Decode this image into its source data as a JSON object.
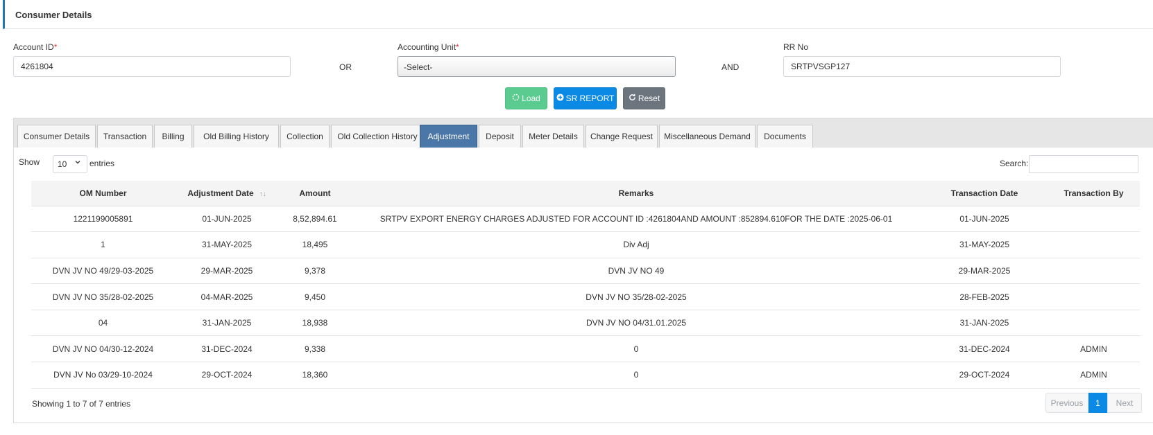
{
  "header": {
    "title": "Consumer Details"
  },
  "form": {
    "account_id": {
      "label": "Account ID",
      "required": "*",
      "value": "4261804"
    },
    "or_label": "OR",
    "accounting_unit": {
      "label": "Accounting Unit",
      "required": "*",
      "value": "-Select-"
    },
    "and_label": "AND",
    "rr_no": {
      "label": "RR No",
      "value": "SRTPVSGP127"
    }
  },
  "buttons": {
    "load": "Load",
    "sr_report": "SR REPORT",
    "reset": "Reset"
  },
  "tabs": [
    "Consumer Details",
    "Transaction",
    "Billing",
    "Old Billing History",
    "Collection",
    "Old Collection History",
    "Adjustment",
    "Deposit",
    "Meter Details",
    "Change Request",
    "Miscellaneous Demand",
    "Documents"
  ],
  "active_tab": "Adjustment",
  "table_controls": {
    "show_label": "Show",
    "page_length": "10",
    "entries_label": "entries",
    "search_label": "Search:"
  },
  "table": {
    "columns": [
      "OM Number",
      "Adjustment Date",
      "Amount",
      "Remarks",
      "Transaction Date",
      "Transaction By"
    ],
    "sort_icon": "↑↓",
    "rows": [
      [
        "1221199005891",
        "01-JUN-2025",
        "8,52,894.61",
        "SRTPV EXPORT ENERGY CHARGES ADJUSTED FOR ACCOUNT ID :4261804AND AMOUNT :852894.610FOR THE DATE :2025-06-01",
        "01-JUN-2025",
        ""
      ],
      [
        "1",
        "31-MAY-2025",
        "18,495",
        "Div Adj",
        "31-MAY-2025",
        ""
      ],
      [
        "DVN JV NO 49/29-03-2025",
        "29-MAR-2025",
        "9,378",
        "DVN JV NO 49",
        "29-MAR-2025",
        ""
      ],
      [
        "DVN JV NO 35/28-02-2025",
        "04-MAR-2025",
        "9,450",
        "DVN JV NO 35/28-02-2025",
        "28-FEB-2025",
        ""
      ],
      [
        "04",
        "31-JAN-2025",
        "18,938",
        "DVN JV NO 04/31.01.2025",
        "31-JAN-2025",
        ""
      ],
      [
        "DVN JV NO 04/30-12-2024",
        "31-DEC-2024",
        "9,338",
        "0",
        "31-DEC-2024",
        "ADMIN"
      ],
      [
        "DVN JV No 03/29-10-2024",
        "29-OCT-2024",
        "18,360",
        "0",
        "29-OCT-2024",
        "ADMIN"
      ]
    ]
  },
  "footer": {
    "info": "Showing 1 to 7 of 7 entries",
    "previous": "Previous",
    "page": "1",
    "next": "Next"
  },
  "colors": {
    "accent_bar": "#1f77b4",
    "load_button": "#5bcb8f",
    "sr_button": "#0b8ae5",
    "reset_button": "#6c757d",
    "active_tab": "#4a76a8"
  },
  "icons": {
    "load": "spinner-icon",
    "sr_report": "plus-circle-icon",
    "reset": "refresh-icon",
    "select": "chevron-down-icon"
  }
}
